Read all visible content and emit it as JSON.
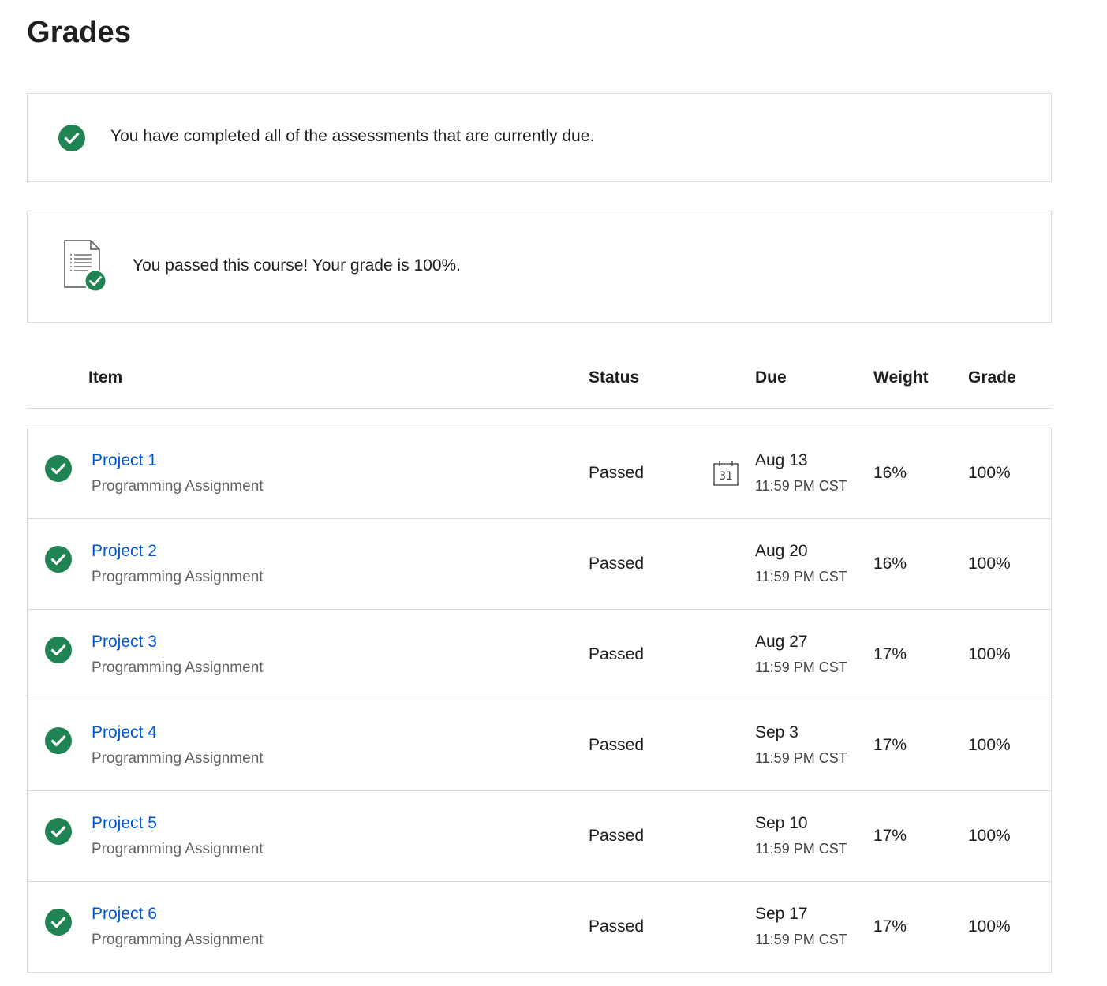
{
  "page": {
    "title": "Grades"
  },
  "banners": {
    "due_message": "You have completed all of the assessments that are currently due.",
    "passed_message": "You passed this course! Your grade is 100%."
  },
  "table": {
    "headers": {
      "item": "Item",
      "status": "Status",
      "due": "Due",
      "weight": "Weight",
      "grade": "Grade"
    },
    "calendar_icon_day": "31",
    "rows": [
      {
        "title": "Project 1",
        "type": "Programming Assignment",
        "status": "Passed",
        "due_date": "Aug 13",
        "due_time": "11:59 PM CST",
        "weight": "16%",
        "grade": "100%"
      },
      {
        "title": "Project 2",
        "type": "Programming Assignment",
        "status": "Passed",
        "due_date": "Aug 20",
        "due_time": "11:59 PM CST",
        "weight": "16%",
        "grade": "100%"
      },
      {
        "title": "Project 3",
        "type": "Programming Assignment",
        "status": "Passed",
        "due_date": "Aug 27",
        "due_time": "11:59 PM CST",
        "weight": "17%",
        "grade": "100%"
      },
      {
        "title": "Project 4",
        "type": "Programming Assignment",
        "status": "Passed",
        "due_date": "Sep 3",
        "due_time": "11:59 PM CST",
        "weight": "17%",
        "grade": "100%"
      },
      {
        "title": "Project 5",
        "type": "Programming Assignment",
        "status": "Passed",
        "due_date": "Sep 10",
        "due_time": "11:59 PM CST",
        "weight": "17%",
        "grade": "100%"
      },
      {
        "title": "Project 6",
        "type": "Programming Assignment",
        "status": "Passed",
        "due_date": "Sep 17",
        "due_time": "11:59 PM CST",
        "weight": "17%",
        "grade": "100%"
      }
    ]
  },
  "icons": {
    "status_check": "check-circle-icon",
    "course_passed": "document-check-icon",
    "calendar": "calendar-icon"
  },
  "colors": {
    "success_green": "#1f8354",
    "link_blue": "#0056d2",
    "border": "#dcdcdc"
  }
}
